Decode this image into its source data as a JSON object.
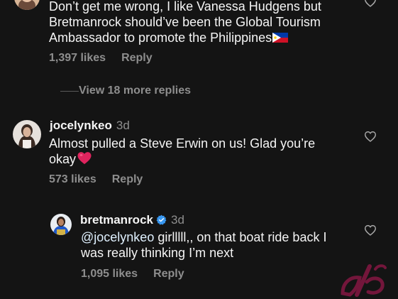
{
  "comments": [
    {
      "text_line1": "Don’t get me wrong, I like Vanessa Hudgens but",
      "text_line2": "Bretmanrock should’ve been the Global Tourism",
      "text_line3": "Ambassador to promote the Philippines",
      "flag_icon": "philippines-flag-icon",
      "likes": "1,397 likes",
      "reply_label": "Reply"
    },
    {
      "username": "jocelynkeo",
      "timestamp": "3d",
      "text_line1": "Almost pulled a Steve Erwin on us! Glad you’re",
      "text_line2": "okay",
      "emoji_icon": "red-heart-icon",
      "likes": "573 likes",
      "reply_label": "Reply"
    },
    {
      "username": "bretmanrock",
      "timestamp": "3d",
      "verified_icon": "verified-badge-icon",
      "mention": "@jocelynkeo",
      "text_line1_rest": " girlllll,, on that boat ride back I",
      "text_line2": "was really thinking I’m next",
      "likes": "1,095 likes",
      "reply_label": "Reply"
    }
  ],
  "view_more_replies": "View 18 more replies",
  "colors": {
    "background": "#141414",
    "primary_text": "#f5f5f5",
    "secondary_text": "#8e8e8e",
    "verified_blue": "#3897f0",
    "heart_red": "#e0245e",
    "watermark": "#c2185b"
  }
}
